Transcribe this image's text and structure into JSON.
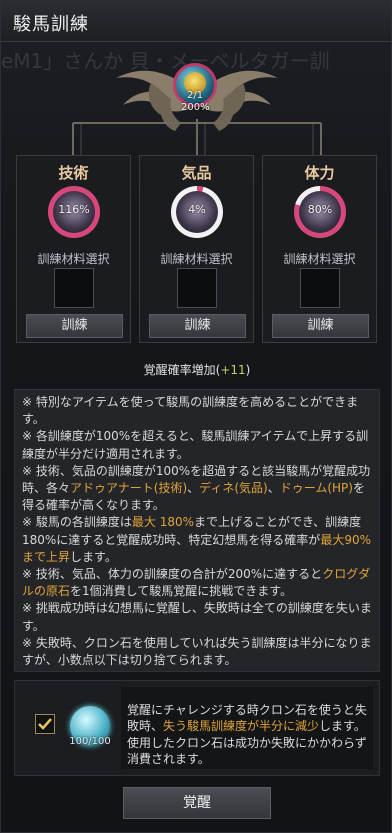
{
  "window": {
    "title": "駿馬訓練",
    "background_text": "eM1」さんか 貝・メーベルタガー訓"
  },
  "main_orb": {
    "count": "2/1",
    "percent": "200%"
  },
  "panels": [
    {
      "title": "技術",
      "percent_label": "116%",
      "percent": 116,
      "material_label": "訓練材料選択",
      "button_label": "訓練"
    },
    {
      "title": "気品",
      "percent_label": "4%",
      "percent": 4,
      "material_label": "訓練材料選択",
      "button_label": "訓練"
    },
    {
      "title": "体力",
      "percent_label": "80%",
      "percent": 80,
      "material_label": "訓練材料選択",
      "button_label": "訓練"
    }
  ],
  "probability": {
    "label": "覚醒確率増加(",
    "bonus": "+11",
    "close": ")"
  },
  "notes": [
    [
      {
        "t": "※ 特別なアイテムを使って駿馬の訓練度を高めることができます。"
      }
    ],
    [
      {
        "t": "※ 各訓練度が100%を超えると、駿馬訓練アイテムで上昇する訓練度が半分だけ適用されます。"
      }
    ],
    [
      {
        "t": "※ 技術、気品の訓練度が100%を超過すると該当駿馬が覚醒成功時、各々"
      },
      {
        "t": "アドゥアナート(技術)",
        "h": true
      },
      {
        "t": "、"
      },
      {
        "t": "ディネ(気品)",
        "h": true
      },
      {
        "t": "、"
      },
      {
        "t": "ドゥーム(HP)",
        "h": true
      },
      {
        "t": "を得る確率が高くなります。"
      }
    ],
    [
      {
        "t": "※ 駿馬の各訓練度は"
      },
      {
        "t": "最大 180%",
        "h": true
      },
      {
        "t": "まで上げることができ、訓練度180%に達すると覚醒成功時、特定幻想馬を得る確率が"
      },
      {
        "t": "最大90%まで上昇",
        "h": true
      },
      {
        "t": "します。"
      }
    ],
    [
      {
        "t": "※ 技術、気品、体力の訓練度の合計が200%に達すると"
      },
      {
        "t": "クログダルの原石",
        "h": true
      },
      {
        "t": "を1個消費して駿馬覚醒に挑戦できます。"
      }
    ],
    [
      {
        "t": "※ 挑戦成功時は幻想馬に覚醒し、失敗時は全ての訓練度を失います。"
      }
    ],
    [
      {
        "t": "※ 失敗時、クロン石を使用していれば失う訓練度は半分になりますが、小数点以下は切り捨てられます。"
      }
    ]
  ],
  "cron": {
    "checked": true,
    "count": "100/100",
    "description": [
      {
        "t": "覚醒にチャレンジする時クロン石を使うと失敗時、"
      },
      {
        "t": "失う駿馬訓練度が半分に減少",
        "h": true
      },
      {
        "t": "します。使用したクロン石は成功か失敗にかかわらず消費されます。"
      }
    ]
  },
  "awaken_button": "覚醒",
  "colors": {
    "highlight": "#e0a43a",
    "ring": "#d8477a",
    "bonus": "#b6d95a"
  }
}
